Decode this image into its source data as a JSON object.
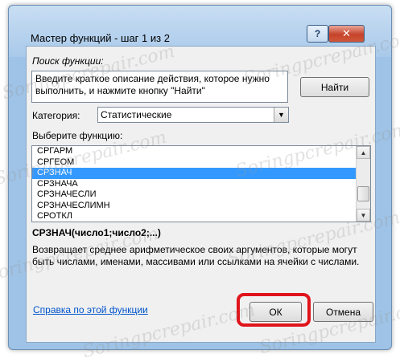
{
  "window": {
    "title": "Мастер функций - шаг 1 из 2",
    "help_btn": "?",
    "close_btn": "✕"
  },
  "search": {
    "label": "Поиск функции:",
    "text": "Введите краткое описание действия, которое нужно выполнить, и нажмите кнопку \"Найти\"",
    "find_button": "Найти"
  },
  "category": {
    "label": "Категория:",
    "selected": "Статистические"
  },
  "functions": {
    "label": "Выберите функцию:",
    "items": [
      "СРГАРМ",
      "СРГЕОМ",
      "СРЗНАЧ",
      "СРЗНАЧА",
      "СРЗНАЧЕСЛИ",
      "СРЗНАЧЕСЛИМН",
      "СРОТКЛ"
    ],
    "selected_index": 2
  },
  "details": {
    "signature": "СРЗНАЧ(число1;число2;...)",
    "description": "Возвращает среднее арифметическое своих аргументов, которые могут быть числами, именами, массивами или ссылками на ячейки с числами."
  },
  "footer": {
    "help_link": "Справка по этой функции",
    "ok_button": "ОК",
    "cancel_button": "Отмена"
  },
  "watermark": "Soringpcrepair.com",
  "colors": {
    "selection": "#3399ff",
    "highlight": "#e0141c",
    "link": "#0055cc"
  }
}
